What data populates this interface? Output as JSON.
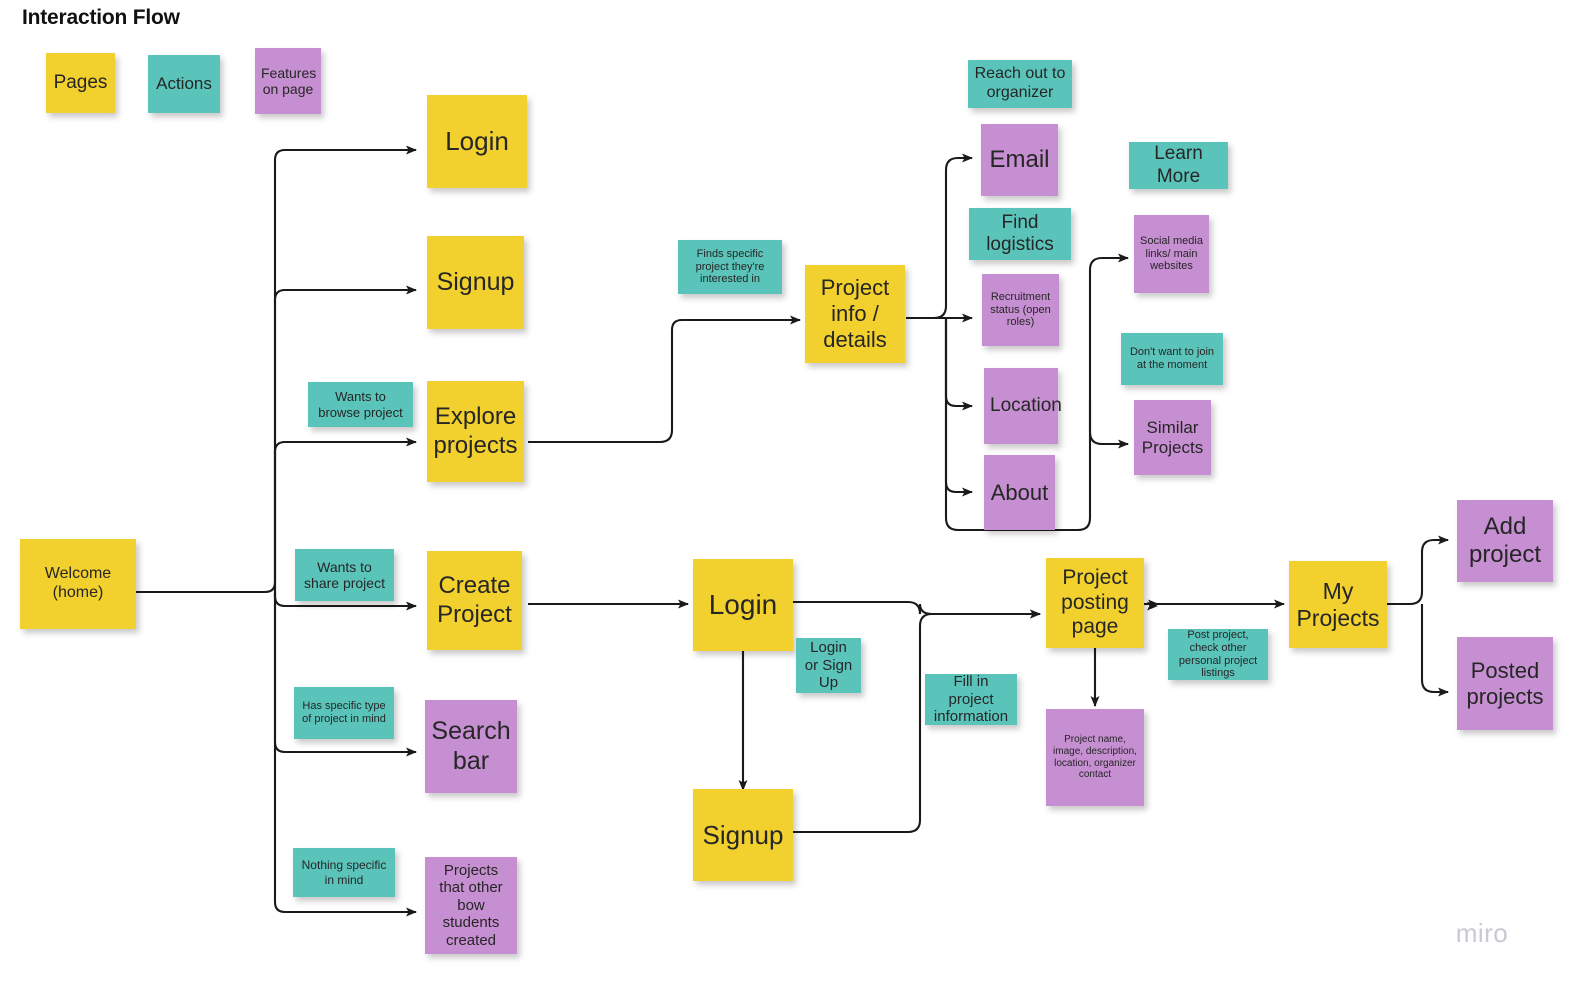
{
  "title": "Interaction Flow",
  "watermark": "miro",
  "colors": {
    "pages": "#F2D02E",
    "actions": "#5BC4BA",
    "features": "#C68FD1",
    "connector": "#1a1a1a",
    "background": "#ffffff",
    "watermark": "#c9c9d4"
  },
  "legend": [
    {
      "label": "Pages",
      "type": "pages"
    },
    {
      "label": "Actions",
      "type": "actions"
    },
    {
      "label": "Features on page",
      "type": "features"
    }
  ],
  "nodes": [
    {
      "id": "welcome",
      "label": "Welcome (home)",
      "type": "pages"
    },
    {
      "id": "login_top",
      "label": "Login",
      "type": "pages"
    },
    {
      "id": "signup_top",
      "label": "Signup",
      "type": "pages"
    },
    {
      "id": "explore",
      "label": "Explore projects",
      "type": "pages"
    },
    {
      "id": "create_project",
      "label": "Create Project",
      "type": "pages"
    },
    {
      "id": "search_bar",
      "label": "Search bar",
      "type": "features"
    },
    {
      "id": "other_projects",
      "label": "Projects that other bow students created",
      "type": "features"
    },
    {
      "id": "wants_browse",
      "label": "Wants to browse project",
      "type": "actions"
    },
    {
      "id": "wants_share",
      "label": "Wants to share project",
      "type": "actions"
    },
    {
      "id": "has_specific",
      "label": "Has specific type of project in mind",
      "type": "actions"
    },
    {
      "id": "nothing_specific",
      "label": "Nothing specific in mind",
      "type": "actions"
    },
    {
      "id": "finds_specific",
      "label": "Finds specific project they're interested in",
      "type": "actions"
    },
    {
      "id": "project_info",
      "label": "Project info / details",
      "type": "pages"
    },
    {
      "id": "reach_out",
      "label": "Reach out to organizer",
      "type": "actions"
    },
    {
      "id": "email",
      "label": "Email",
      "type": "features"
    },
    {
      "id": "find_logistics",
      "label": "Find logistics",
      "type": "actions"
    },
    {
      "id": "recruitment",
      "label": "Recruitment status (open roles)",
      "type": "features"
    },
    {
      "id": "location",
      "label": "Location",
      "type": "features"
    },
    {
      "id": "about",
      "label": "About",
      "type": "features"
    },
    {
      "id": "learn_more",
      "label": "Learn More",
      "type": "actions"
    },
    {
      "id": "social_media",
      "label": "Social media links/ main websites",
      "type": "features"
    },
    {
      "id": "dont_want_join",
      "label": "Don't want to join at the moment",
      "type": "actions"
    },
    {
      "id": "similar_projects",
      "label": "Similar Projects",
      "type": "features"
    },
    {
      "id": "login_mid",
      "label": "Login",
      "type": "pages"
    },
    {
      "id": "login_or_signup",
      "label": "Login or Sign Up",
      "type": "actions"
    },
    {
      "id": "signup_mid",
      "label": "Signup",
      "type": "pages"
    },
    {
      "id": "fill_in",
      "label": "Fill in project information",
      "type": "actions"
    },
    {
      "id": "posting_page",
      "label": "Project posting page",
      "type": "pages"
    },
    {
      "id": "project_fields",
      "label": "Project name, image, description, location, organizer contact",
      "type": "features"
    },
    {
      "id": "post_check",
      "label": "Post project, check other personal project listings",
      "type": "actions"
    },
    {
      "id": "my_projects",
      "label": "My Projects",
      "type": "pages"
    },
    {
      "id": "add_project",
      "label": "Add project",
      "type": "features"
    },
    {
      "id": "posted_projects",
      "label": "Posted projects",
      "type": "features"
    }
  ],
  "connections": [
    {
      "from": "welcome",
      "to": "login_top"
    },
    {
      "from": "welcome",
      "to": "signup_top"
    },
    {
      "from": "welcome",
      "to": "explore"
    },
    {
      "from": "welcome",
      "to": "create_project"
    },
    {
      "from": "welcome",
      "to": "search_bar"
    },
    {
      "from": "welcome",
      "to": "other_projects"
    },
    {
      "from": "explore",
      "to": "project_info"
    },
    {
      "from": "project_info",
      "to": "email"
    },
    {
      "from": "project_info",
      "to": "recruitment"
    },
    {
      "from": "project_info",
      "to": "location"
    },
    {
      "from": "project_info",
      "to": "about"
    },
    {
      "from": "project_info",
      "to": "social_media"
    },
    {
      "from": "project_info",
      "to": "similar_projects"
    },
    {
      "from": "create_project",
      "to": "login_mid"
    },
    {
      "from": "login_mid",
      "to": "signup_mid"
    },
    {
      "from": "login_mid",
      "to": "posting_page"
    },
    {
      "from": "signup_mid",
      "to": "posting_page"
    },
    {
      "from": "posting_page",
      "to": "project_fields"
    },
    {
      "from": "posting_page",
      "to": "my_projects"
    },
    {
      "from": "my_projects",
      "to": "add_project"
    },
    {
      "from": "my_projects",
      "to": "posted_projects"
    }
  ]
}
